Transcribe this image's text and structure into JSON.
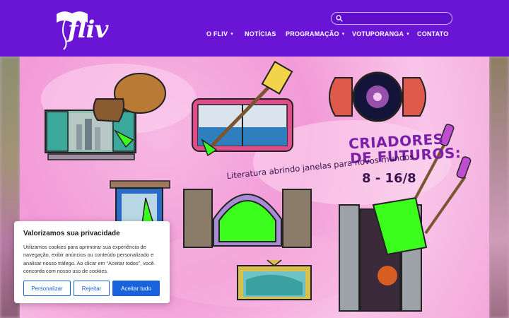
{
  "brand": {
    "name": "fliv"
  },
  "search": {
    "placeholder": ""
  },
  "nav": {
    "items": [
      {
        "label": "O FLIV",
        "has_dropdown": true
      },
      {
        "label": "NOTÍCIAS",
        "has_dropdown": false
      },
      {
        "label": "PROGRAMAÇÃO",
        "has_dropdown": true
      },
      {
        "label": "VOTUPORANGA",
        "has_dropdown": true
      },
      {
        "label": "CONTATO",
        "has_dropdown": false
      }
    ],
    "chevron": "▾"
  },
  "hero": {
    "title_line1": "CRIADORES",
    "title_line2": "DE FUTUROS:",
    "subtitle": "Literatura abrindo janelas para novos mundos.",
    "dates": "8 - 16/8",
    "colors": {
      "title": "#7b1fa8",
      "background": "#f4a8db",
      "accent_green": "#3cff1e"
    }
  },
  "cookie_banner": {
    "title": "Valorizamos sua privacidade",
    "text": "Utilizamos cookies para aprimorar sua experiência de navegação, exibir anúncios ou conteúdo personalizado e analisar nosso tráfego. Ao clicar em “Aceitar todos”, você concorda com nosso uso de cookies.",
    "buttons": {
      "customize": "Personalizar",
      "reject": "Rejeitar",
      "accept": "Aceitar tudo"
    },
    "colors": {
      "primary": "#1863dc"
    }
  },
  "colors": {
    "header_bg": "#6a14d6"
  }
}
